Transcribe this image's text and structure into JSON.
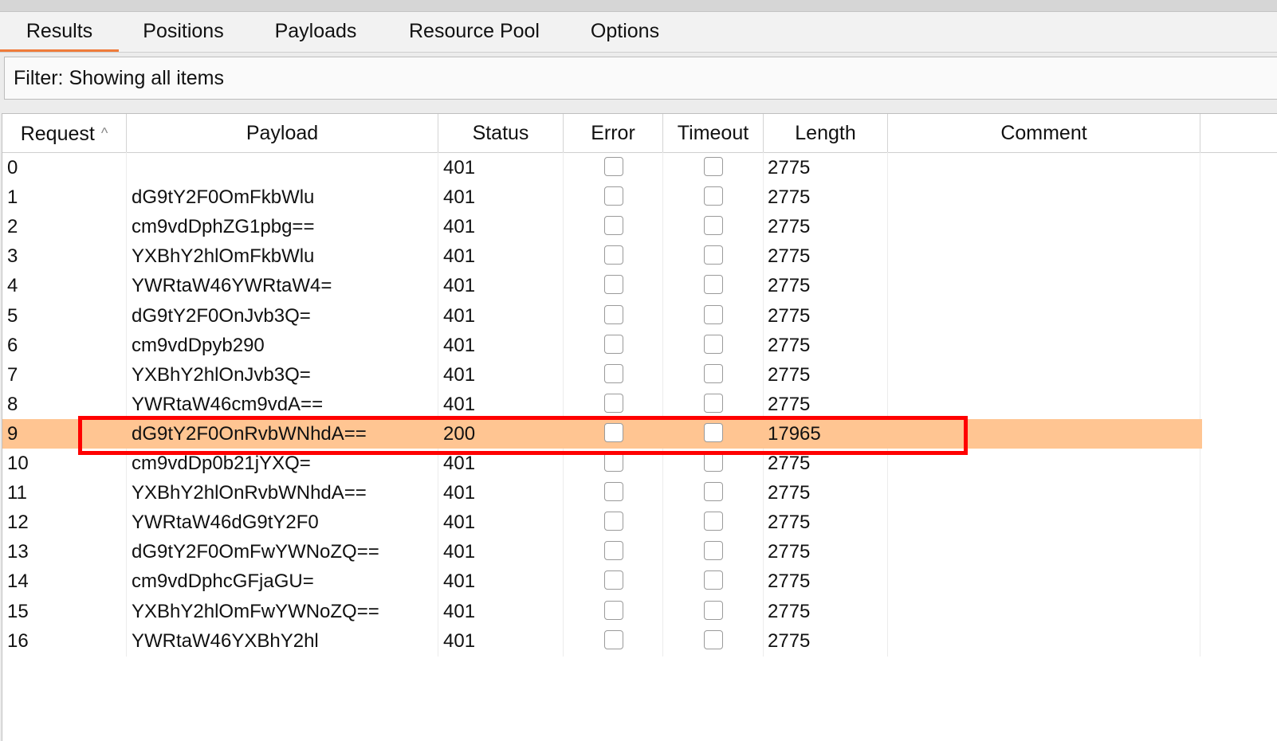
{
  "tabs": [
    {
      "label": "Results",
      "active": true
    },
    {
      "label": "Positions",
      "active": false
    },
    {
      "label": "Payloads",
      "active": false
    },
    {
      "label": "Resource Pool",
      "active": false
    },
    {
      "label": "Options",
      "active": false
    }
  ],
  "filter": {
    "text": "Filter: Showing all items"
  },
  "table": {
    "columns": [
      "Request",
      "Payload",
      "Status",
      "Error",
      "Timeout",
      "Length",
      "Comment"
    ],
    "sort_indicator": "^",
    "highlighted_request": "9",
    "rows": [
      {
        "request": "0",
        "payload": "",
        "status": "401",
        "error": false,
        "timeout": false,
        "length": "2775",
        "comment": ""
      },
      {
        "request": "1",
        "payload": "dG9tY2F0OmFkbWlu",
        "status": "401",
        "error": false,
        "timeout": false,
        "length": "2775",
        "comment": ""
      },
      {
        "request": "2",
        "payload": "cm9vdDphZG1pbg==",
        "status": "401",
        "error": false,
        "timeout": false,
        "length": "2775",
        "comment": ""
      },
      {
        "request": "3",
        "payload": "YXBhY2hlOmFkbWlu",
        "status": "401",
        "error": false,
        "timeout": false,
        "length": "2775",
        "comment": ""
      },
      {
        "request": "4",
        "payload": "YWRtaW46YWRtaW4=",
        "status": "401",
        "error": false,
        "timeout": false,
        "length": "2775",
        "comment": ""
      },
      {
        "request": "5",
        "payload": "dG9tY2F0OnJvb3Q=",
        "status": "401",
        "error": false,
        "timeout": false,
        "length": "2775",
        "comment": ""
      },
      {
        "request": "6",
        "payload": "cm9vdDpyb290",
        "status": "401",
        "error": false,
        "timeout": false,
        "length": "2775",
        "comment": ""
      },
      {
        "request": "7",
        "payload": "YXBhY2hlOnJvb3Q=",
        "status": "401",
        "error": false,
        "timeout": false,
        "length": "2775",
        "comment": ""
      },
      {
        "request": "8",
        "payload": "YWRtaW46cm9vdA==",
        "status": "401",
        "error": false,
        "timeout": false,
        "length": "2775",
        "comment": ""
      },
      {
        "request": "9",
        "payload": "dG9tY2F0OnRvbWNhdA==",
        "status": "200",
        "error": false,
        "timeout": false,
        "length": "17965",
        "comment": ""
      },
      {
        "request": "10",
        "payload": "cm9vdDp0b21jYXQ=",
        "status": "401",
        "error": false,
        "timeout": false,
        "length": "2775",
        "comment": ""
      },
      {
        "request": "11",
        "payload": "YXBhY2hlOnRvbWNhdA==",
        "status": "401",
        "error": false,
        "timeout": false,
        "length": "2775",
        "comment": ""
      },
      {
        "request": "12",
        "payload": "YWRtaW46dG9tY2F0",
        "status": "401",
        "error": false,
        "timeout": false,
        "length": "2775",
        "comment": ""
      },
      {
        "request": "13",
        "payload": "dG9tY2F0OmFwYWNoZQ==",
        "status": "401",
        "error": false,
        "timeout": false,
        "length": "2775",
        "comment": ""
      },
      {
        "request": "14",
        "payload": "cm9vdDphcGFjaGU=",
        "status": "401",
        "error": false,
        "timeout": false,
        "length": "2775",
        "comment": ""
      },
      {
        "request": "15",
        "payload": "YXBhY2hlOmFwYWNoZQ==",
        "status": "401",
        "error": false,
        "timeout": false,
        "length": "2775",
        "comment": ""
      },
      {
        "request": "16",
        "payload": "YWRtaW46YXBhY2hl",
        "status": "401",
        "error": false,
        "timeout": false,
        "length": "2775",
        "comment": ""
      }
    ]
  },
  "colors": {
    "accent": "#ef7b3a",
    "highlight_row": "#ffc592",
    "annotation_box": "#ff0000"
  }
}
